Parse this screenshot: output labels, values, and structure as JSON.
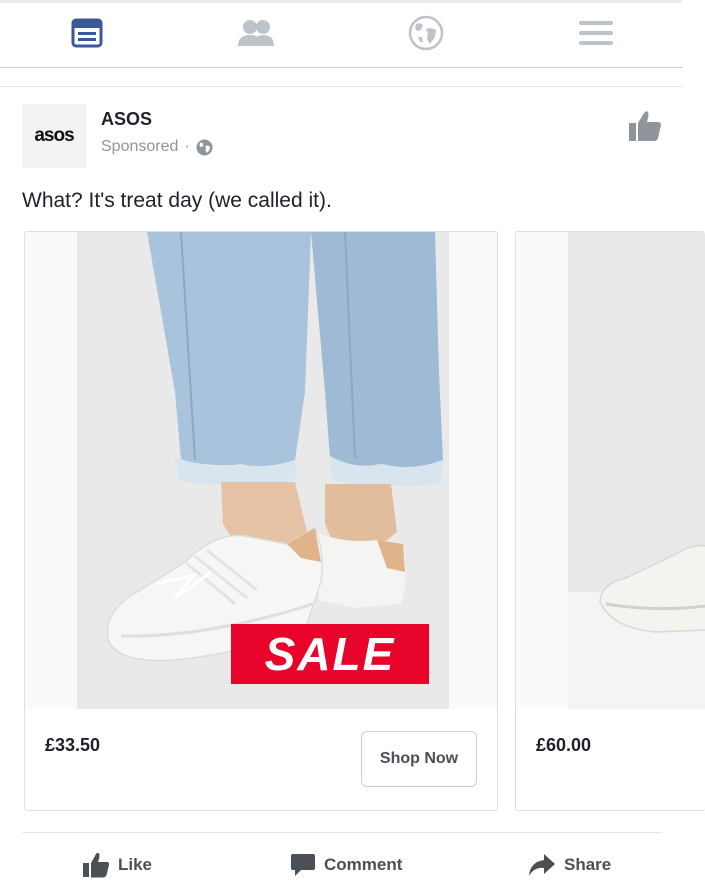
{
  "nav": {
    "items": [
      "news-feed",
      "friends",
      "notifications",
      "menu"
    ]
  },
  "post": {
    "page_name": "ASOS",
    "avatar_text": "asos",
    "sponsored": "Sponsored",
    "separator": "·",
    "caption": "What? It's treat day (we called it)."
  },
  "carousel": {
    "cards": [
      {
        "price": "£33.50",
        "badge": "SALE",
        "cta": "Shop Now"
      },
      {
        "price": "£60.00"
      }
    ]
  },
  "actions": {
    "like": "Like",
    "comment": "Comment",
    "share": "Share"
  },
  "colors": {
    "accent": "#3b5998",
    "inactive_icon": "#bec2c9",
    "sale_red": "#e8032b",
    "secondary_text": "#90949c"
  }
}
